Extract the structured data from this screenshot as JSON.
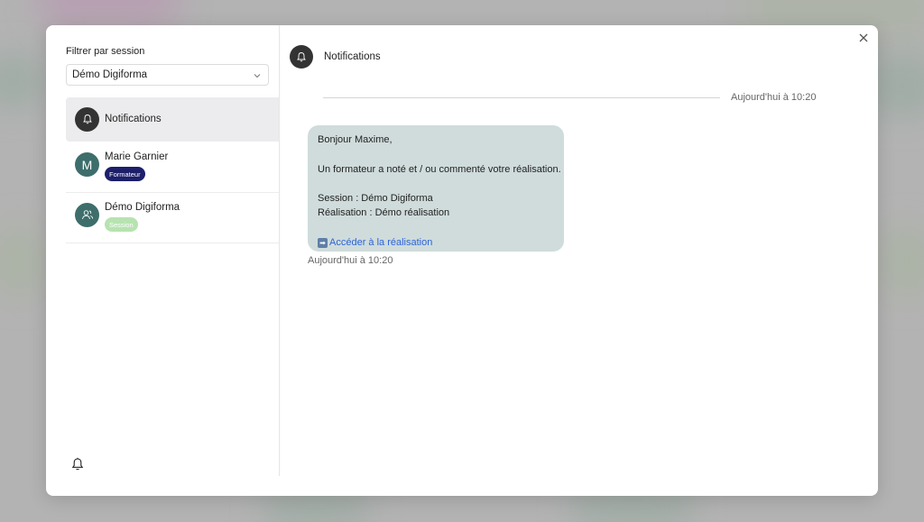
{
  "sidebar": {
    "filter_label": "Filtrer par session",
    "session_select": {
      "value": "Démo Digiforma"
    },
    "conversations": [
      {
        "title": "Notifications",
        "icon": "bell-icon",
        "avatar_bg": "#333333",
        "active": true
      },
      {
        "title": "Marie Garnier",
        "avatar_letter": "M",
        "avatar_bg": "#3d6e6b",
        "badge": {
          "label": "Formateur",
          "bg": "#1d1f6b",
          "fg": "#ffffff"
        }
      },
      {
        "title": "Démo Digiforma",
        "icon": "users-icon",
        "avatar_bg": "#3d6e6b",
        "badge": {
          "label": "Session",
          "bg": "#b7e3b0",
          "fg": "#ffffff"
        }
      }
    ]
  },
  "main": {
    "header_title": "Notifications",
    "divider_time": "Aujourd'hui à 10:20",
    "message": {
      "greeting": "Bonjour Maxime,",
      "line1": "Un formateur a noté et / ou commenté votre réalisation.",
      "session_line": "Session : Démo Digiforma",
      "realisation_line": "Réalisation : Démo réalisation",
      "link_label": "Accéder à la réalisation",
      "time": "Aujourd'hui à 10:20"
    }
  },
  "colors": {
    "bubble": "#cfdcdb",
    "link": "#2d63d8",
    "active_item": "#ececee"
  }
}
